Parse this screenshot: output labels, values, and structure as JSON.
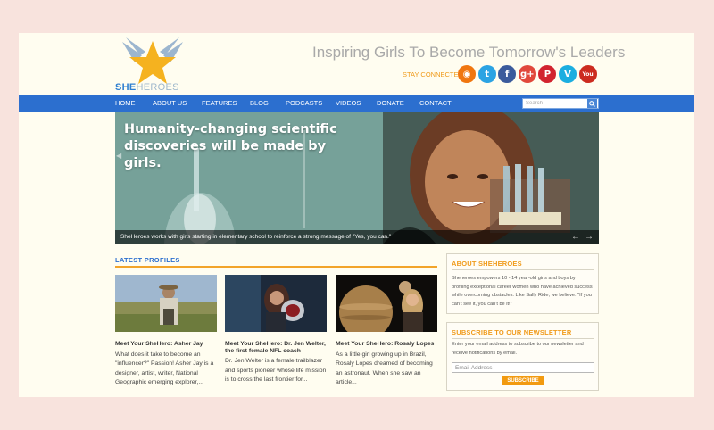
{
  "header": {
    "logo_text_she": "SHE",
    "logo_text_heroes": "HEROES",
    "tagline": "Inspiring Girls To Become Tomorrow's Leaders",
    "stay_connected": "STAY CONNECTED",
    "socials": [
      {
        "name": "rss-icon",
        "glyph": "◉",
        "color": "#f0760f"
      },
      {
        "name": "twitter-icon",
        "glyph": "t",
        "color": "#2ba3e3"
      },
      {
        "name": "facebook-icon",
        "glyph": "f",
        "color": "#3b5b9c"
      },
      {
        "name": "google-plus-icon",
        "glyph": "g+",
        "color": "#e1483b"
      },
      {
        "name": "pinterest-icon",
        "glyph": "P",
        "color": "#d2232f"
      },
      {
        "name": "vimeo-icon",
        "glyph": "V",
        "color": "#1baee0"
      },
      {
        "name": "youtube-icon",
        "glyph": "You",
        "color": "#cc2b1f"
      }
    ]
  },
  "nav": {
    "items": [
      "HOME",
      "ABOUT US",
      "FEATURES",
      "BLOG",
      "PODCASTS",
      "VIDEOS",
      "DONATE",
      "CONTACT"
    ],
    "search_placeholder": "Search"
  },
  "hero": {
    "headline": "Humanity-changing scientific discoveries will be made by girls.",
    "caption": "SheHeroes works with girls starting in elementary school to reinforce a strong message of \"Yes, you can.\"",
    "prev": "←",
    "next": "→",
    "side_arrow": "◀"
  },
  "profiles_section": {
    "title": "LATEST PROFILES",
    "items": [
      {
        "title": "Meet Your SheHero: Asher Jay",
        "excerpt": "What does it take to become an \"influencer?\" Passion! Asher Jay is a designer, artist, writer, National Geographic emerging explorer,..."
      },
      {
        "title": "Meet Your SheHero: Dr. Jen Welter, the first female NFL coach",
        "excerpt": "Dr. Jen Welter is a female trailblazer and sports pioneer whose life mission is to cross the last frontier for..."
      },
      {
        "title": "Meet Your SheHero: Rosaly Lopes",
        "excerpt": "As a little girl growing up in Brazil, Rosaly Lopes dreamed of becoming an astronaut. When she saw an article..."
      }
    ]
  },
  "about": {
    "title": "ABOUT SHEHEROES",
    "text": "Sheheroes empowers 10 - 14 year-old girls and boys by profiling exceptional career women who have achieved success while overcoming obstacles. Like Sally Ride, we believe: \"If you can't see it, you can't be it!\""
  },
  "newsletter": {
    "title": "SUBSCRIBE TO OUR NEWSLETTER",
    "text": "Enter your email address to subscribe to our newsletter and receive notifications by email.",
    "email_placeholder": "Email Address",
    "button": "SUBSCRIBE"
  }
}
